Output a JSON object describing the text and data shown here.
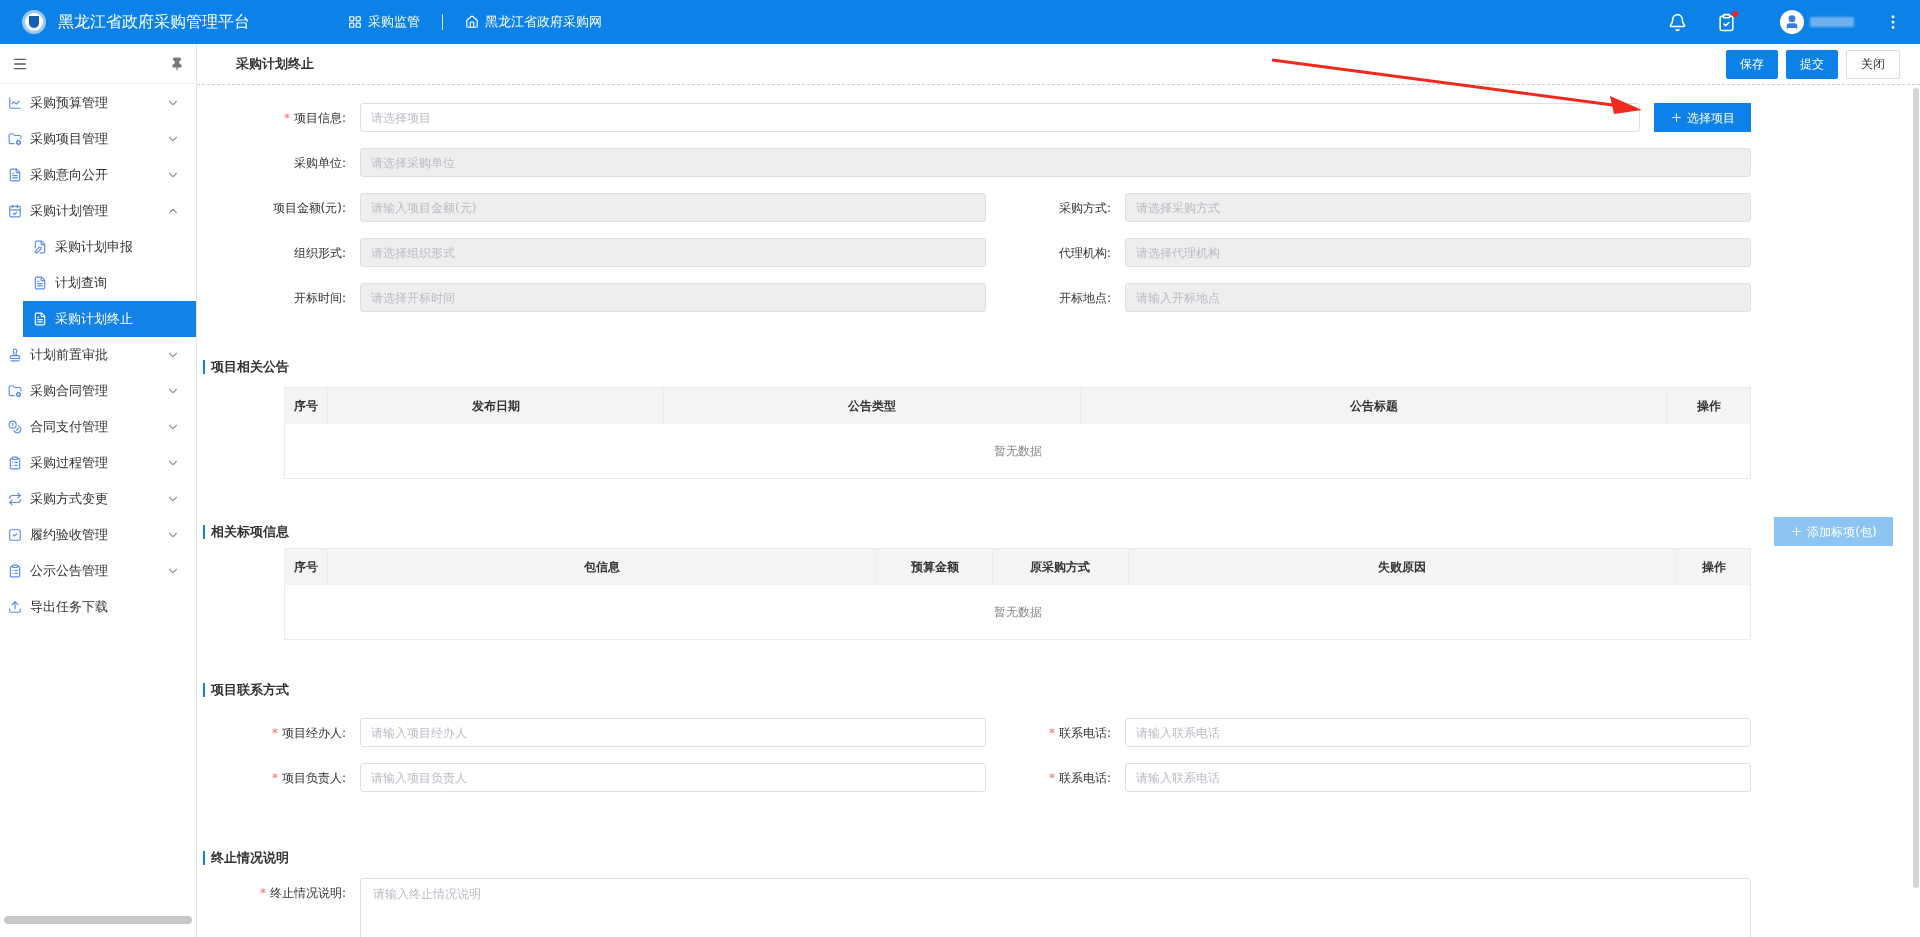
{
  "header": {
    "title": "黑龙江省政府采购管理平台",
    "nav": [
      {
        "kind": "grid",
        "label": "采购监管"
      },
      {
        "kind": "home",
        "label": "黑龙江省政府采购网"
      }
    ],
    "task_badge": true
  },
  "sidebar": {
    "items": [
      {
        "label": "采购预算管理",
        "expanded": false
      },
      {
        "label": "采购项目管理",
        "expanded": false
      },
      {
        "label": "采购意向公开",
        "expanded": false
      },
      {
        "label": "采购计划管理",
        "expanded": true,
        "children": [
          {
            "label": "采购计划申报",
            "selected": false
          },
          {
            "label": "计划查询",
            "selected": false
          },
          {
            "label": "采购计划终止",
            "selected": true
          }
        ]
      },
      {
        "label": "计划前置审批",
        "expanded": false
      },
      {
        "label": "采购合同管理",
        "expanded": false
      },
      {
        "label": "合同支付管理",
        "expanded": false
      },
      {
        "label": "采购过程管理",
        "expanded": false
      },
      {
        "label": "采购方式变更",
        "expanded": false
      },
      {
        "label": "履约验收管理",
        "expanded": false
      },
      {
        "label": "公示公告管理",
        "expanded": false
      },
      {
        "label": "导出任务下载"
      }
    ]
  },
  "page": {
    "title": "采购计划终止",
    "actions": [
      {
        "label": "保存",
        "primary": true
      },
      {
        "label": "提交",
        "primary": true
      },
      {
        "label": "关闭",
        "primary": false
      }
    ]
  },
  "form": {
    "project": {
      "label": "项目信息:",
      "mark": "*",
      "placeholder": "请选择项目",
      "button": "选择项目"
    },
    "unit": {
      "label": "采购单位:",
      "placeholder": "请选择采购单位",
      "disabled": true
    },
    "pairs": [
      [
        {
          "label": "项目金额(元):",
          "placeholder": "请输入项目金额(元)",
          "disabled": true
        },
        {
          "label": "采购方式:",
          "placeholder": "请选择采购方式",
          "disabled": true
        }
      ],
      [
        {
          "label": "组织形式:",
          "placeholder": "请选择组织形式",
          "disabled": true
        },
        {
          "label": "代理机构:",
          "placeholder": "请选择代理机构",
          "disabled": true
        }
      ],
      [
        {
          "label": "开标时间:",
          "placeholder": "请选择开标时间",
          "disabled": true
        },
        {
          "label": "开标地点:",
          "placeholder": "请输入开标地点",
          "disabled": true
        }
      ]
    ]
  },
  "notices": {
    "title": "项目相关公告",
    "columns": [
      "序号",
      "发布日期",
      "公告类型",
      "公告标题",
      "操作"
    ],
    "empty": "暂无数据"
  },
  "lots": {
    "title": "相关标项信息",
    "add_button": {
      "label": "添加标项(包)",
      "disabled": true
    },
    "columns": [
      "序号",
      "包信息",
      "预算金额",
      "原采购方式",
      "失败原因",
      "操作"
    ],
    "empty": "暂无数据"
  },
  "contact": {
    "title": "项目联系方式",
    "pairs": [
      [
        {
          "label": "项目经办人:",
          "placeholder": "请输入项目经办人",
          "disabled": false,
          "mark": "*"
        },
        {
          "label": "联系电话:",
          "placeholder": "请输入联系电话",
          "disabled": false,
          "mark": "*"
        }
      ],
      [
        {
          "label": "项目负责人:",
          "placeholder": "请输入项目负责人",
          "disabled": false,
          "mark": "*"
        },
        {
          "label": "联系电话:",
          "placeholder": "请输入联系电话",
          "disabled": false,
          "mark": "*"
        }
      ]
    ]
  },
  "termination": {
    "title": "终止情况说明",
    "label": "终止情况说明:",
    "mark": "*",
    "placeholder": "请输入终止情况说明"
  }
}
